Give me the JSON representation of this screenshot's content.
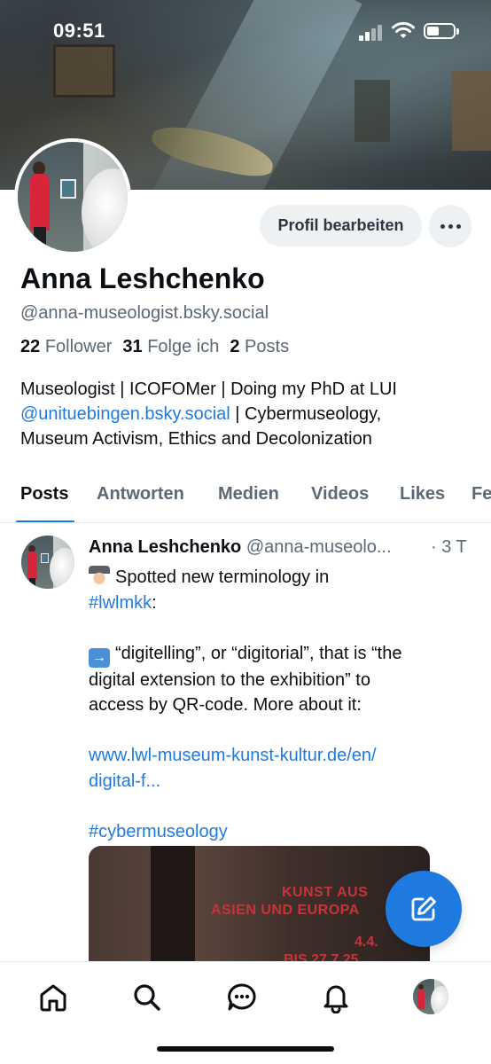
{
  "status_bar": {
    "time": "09:51",
    "icons": [
      "cellular-signal-icon",
      "wifi-icon",
      "battery-icon"
    ]
  },
  "profile": {
    "name": "Anna Leshchenko",
    "handle": "@anna-museologist.bsky.social",
    "edit_button_label": "Profil bearbeiten",
    "more_button_icon": "more-dots-icon",
    "stats": {
      "followers_count": "22",
      "followers_label": "Follower",
      "following_count": "31",
      "following_label": "Folge ich",
      "posts_count": "2",
      "posts_label": "Posts"
    },
    "bio": {
      "line1": "Museologist | ICOFOMer | Doing my PhD at LUI",
      "mention": "@unituebingen.bsky.social",
      "line2_rest": " | Cybermuseology,",
      "line3": "Museum Activism, Ethics and Decolonization"
    }
  },
  "tabs": [
    {
      "label": "Posts",
      "active": true
    },
    {
      "label": "Antworten",
      "active": false
    },
    {
      "label": "Medien",
      "active": false
    },
    {
      "label": "Videos",
      "active": false
    },
    {
      "label": "Likes",
      "active": false
    },
    {
      "label": "Fe",
      "active": false
    }
  ],
  "post": {
    "author": "Anna Leshchenko",
    "handle": "@anna-museolo...",
    "time": "· 3 T",
    "line1": "Spotted new terminology in",
    "hashtag1": "#lwlmkk",
    "hashtag1_suffix": ":",
    "line2": "“digitelling”, or “digitorial”, that is “the",
    "line3": "digital extension to the exhibition” to",
    "line4": "access by QR-code. More about it:",
    "url_line1": "www.lwl-museum-kunst-kultur.de/en/",
    "url_line2": "digital-f...",
    "hashtag2": "#cybermuseology",
    "image_text": {
      "t1": "KUNST AUS",
      "t2": "ASIEN UND EUROPA",
      "t3": "4.4.",
      "t4": "BIS 27.7.25"
    }
  },
  "fab": {
    "icon": "compose-icon"
  },
  "bottom_nav": [
    {
      "icon": "home-icon"
    },
    {
      "icon": "search-icon"
    },
    {
      "icon": "chat-icon"
    },
    {
      "icon": "bell-icon"
    },
    {
      "icon": "profile-avatar"
    }
  ],
  "colors": {
    "accent": "#1f7ae0",
    "text_primary": "#0b0f14",
    "text_secondary": "#5b6875",
    "button_bg": "#eef1f4"
  }
}
